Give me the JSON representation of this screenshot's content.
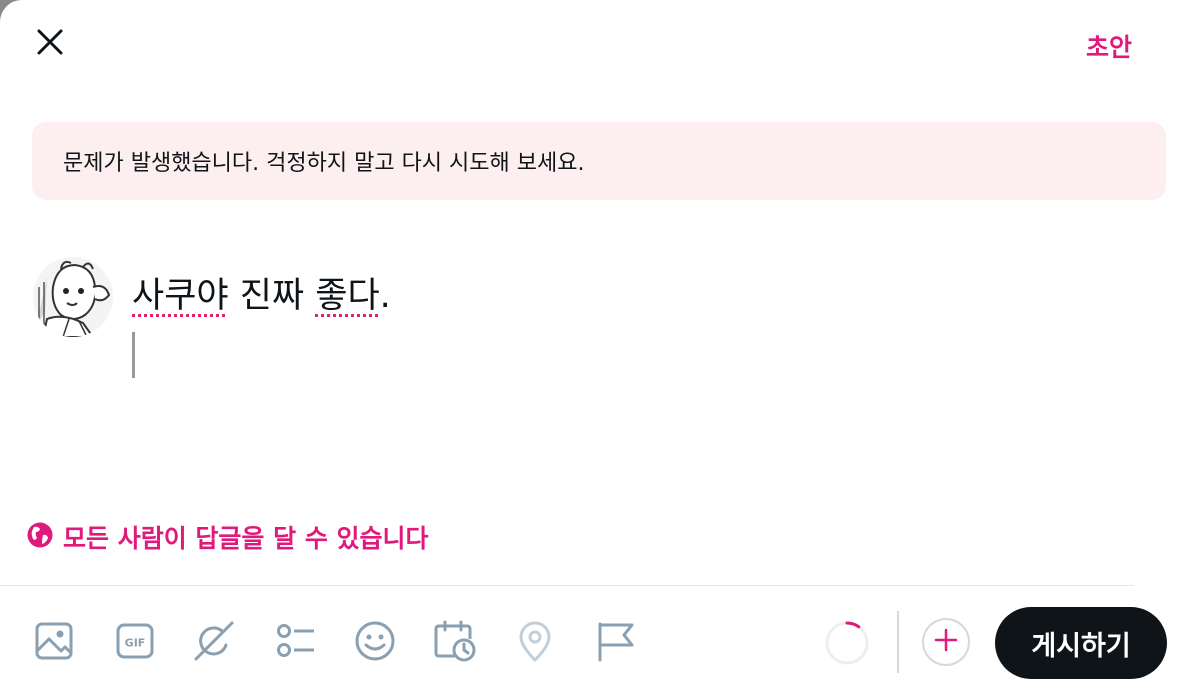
{
  "header": {
    "close_icon": "close-icon",
    "drafts_label": "초안"
  },
  "error_banner": {
    "message": "문제가 발생했습니다. 걱정하지 말고 다시 시도해 보세요."
  },
  "composer": {
    "segments": [
      {
        "text": "사쿠야",
        "misspelled": true
      },
      {
        "text": " 진짜 ",
        "misspelled": false
      },
      {
        "text": "좋다",
        "misspelled": true
      },
      {
        "text": ".",
        "misspelled": false
      }
    ]
  },
  "reply_setting": {
    "icon": "globe-icon",
    "label": "모든 사람이 답글을 달 수 있습니다"
  },
  "toolbar": {
    "icons": [
      "image-icon",
      "gif-icon",
      "grok-icon",
      "poll-icon",
      "emoji-icon",
      "schedule-icon",
      "location-icon",
      "flag-icon"
    ],
    "progress": 0.1,
    "add_icon": "plus-icon",
    "post_label": "게시하기"
  },
  "colors": {
    "accent": "#e0197d",
    "icon": "#8a9fb0",
    "banner_bg": "#fdeeef",
    "post_button_bg": "#0f1419"
  }
}
